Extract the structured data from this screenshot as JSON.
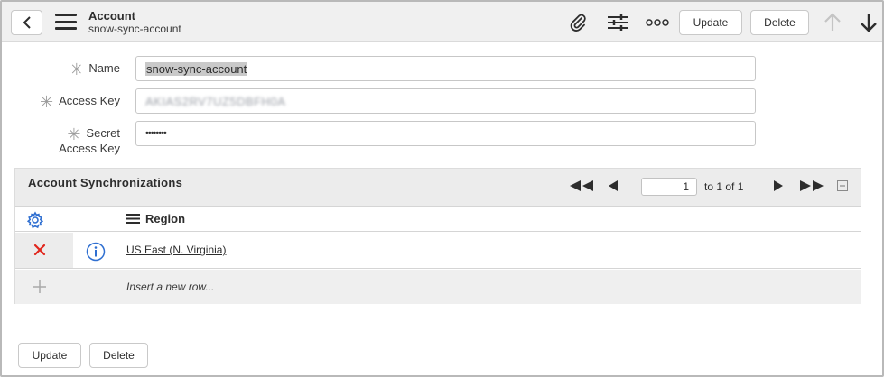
{
  "header": {
    "title": "Account",
    "subtitle": "snow-sync-account",
    "update_label": "Update",
    "delete_label": "Delete",
    "icons": [
      "back-icon",
      "menu-icon",
      "paperclip-icon",
      "settings-sliders-icon",
      "more-icon",
      "arrow-up-icon",
      "arrow-down-icon"
    ]
  },
  "form": {
    "name": {
      "label": "Name",
      "value": "snow-sync-account",
      "required": true
    },
    "access_key": {
      "label": "Access Key",
      "value": "AKIAS2RV7UZ5DBFH0A",
      "required": true
    },
    "secret_access_key": {
      "label_line1": "Secret",
      "label_line2": "Access Key",
      "value": "••••••••",
      "required": true
    }
  },
  "related_list": {
    "title": "Account Synchronizations",
    "page_value": "1",
    "page_of": "to 1 of 1",
    "column_header": "Region",
    "rows": [
      {
        "region": "US East (N. Virginia)"
      }
    ],
    "insert_placeholder": "Insert a new row..."
  },
  "footer": {
    "update_label": "Update",
    "delete_label": "Delete"
  },
  "colors": {
    "header_bg": "#f0f0f0",
    "delete_x": "#e1261c",
    "info_blue": "#2f6fd1",
    "gear_blue": "#2f6fd1"
  }
}
